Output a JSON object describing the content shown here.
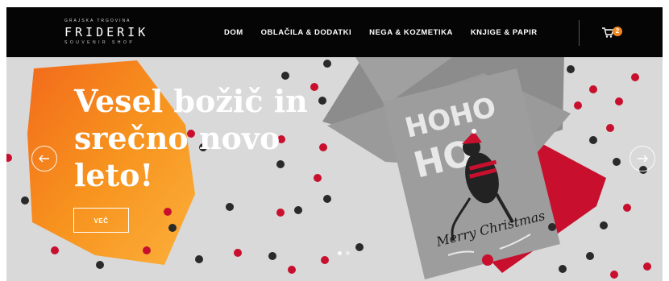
{
  "header": {
    "logo": {
      "top": "GRAJSKA TRGOVINA",
      "name": "FRIDERIK",
      "sub": "SOUVENIR SHOP"
    },
    "nav": [
      "DOM",
      "OBLAČILA & DODATKI",
      "NEGA & KOZMETIKA",
      "KNJIGE & PAPIR"
    ],
    "cart": {
      "count": "2",
      "icon": "cart-icon"
    }
  },
  "hero": {
    "headline": [
      "Vesel božič in",
      "srečno novo",
      "leto!"
    ],
    "button": "VEČ",
    "card": {
      "text": "Merry Christmas",
      "big": "HOHO HO"
    },
    "slides": {
      "count": 2,
      "active": 1
    }
  },
  "colors": {
    "header_bg": "#050505",
    "accent": "#f5871f",
    "hero_bg": "#d9d9d9",
    "red": "#c8102e",
    "dark": "#2a2a2a"
  }
}
